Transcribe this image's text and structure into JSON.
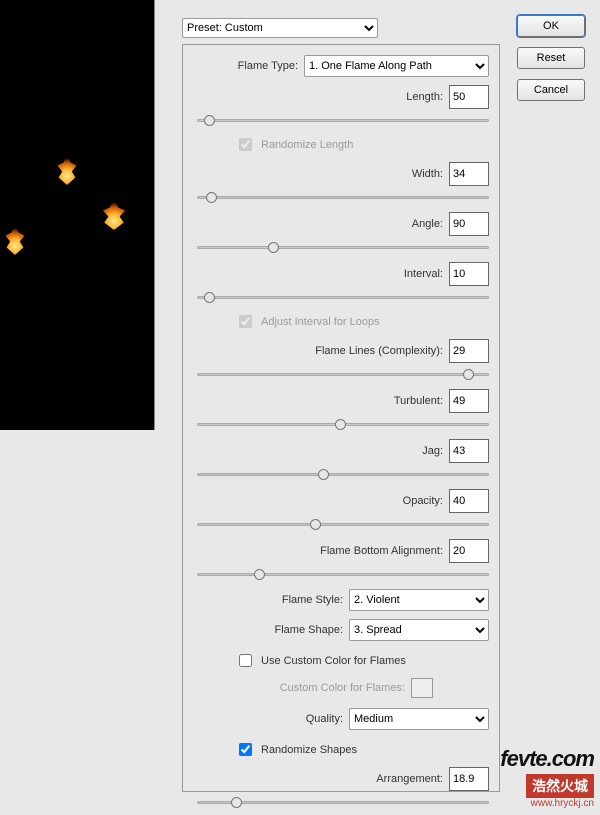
{
  "preset": {
    "label": "Preset: Custom"
  },
  "buttons": {
    "ok": "OK",
    "reset": "Reset",
    "cancel": "Cancel"
  },
  "flameType": {
    "label": "Flame Type:",
    "value": "1. One Flame Along Path"
  },
  "length": {
    "label": "Length:",
    "value": "50",
    "pos": 2
  },
  "randomizeLength": {
    "label": "Randomize Length",
    "checked": true
  },
  "width": {
    "label": "Width:",
    "value": "34",
    "pos": 3
  },
  "angle": {
    "label": "Angle:",
    "value": "90",
    "pos": 25
  },
  "interval": {
    "label": "Interval:",
    "value": "10",
    "pos": 2
  },
  "adjustInterval": {
    "label": "Adjust Interval for Loops",
    "checked": true
  },
  "complexity": {
    "label": "Flame Lines (Complexity):",
    "value": "29",
    "pos": 95
  },
  "turbulent": {
    "label": "Turbulent:",
    "value": "49",
    "pos": 49
  },
  "jag": {
    "label": "Jag:",
    "value": "43",
    "pos": 43
  },
  "opacity": {
    "label": "Opacity:",
    "value": "40",
    "pos": 40
  },
  "bottomAlign": {
    "label": "Flame Bottom Alignment:",
    "value": "20",
    "pos": 20
  },
  "flameStyle": {
    "label": "Flame Style:",
    "value": "2. Violent"
  },
  "flameShape": {
    "label": "Flame Shape:",
    "value": "3. Spread"
  },
  "useCustomColor": {
    "label": "Use Custom Color for Flames",
    "checked": false
  },
  "customColor": {
    "label": "Custom Color for Flames:"
  },
  "quality": {
    "label": "Quality:",
    "value": "Medium"
  },
  "randomizeShapes": {
    "label": "Randomize Shapes",
    "checked": true
  },
  "arrangement": {
    "label": "Arrangement:",
    "value": "18.9",
    "pos": 12
  },
  "watermark": {
    "line1": "fevte.com",
    "line2": "浩然火城",
    "line3": "www.hryckj.cn"
  }
}
